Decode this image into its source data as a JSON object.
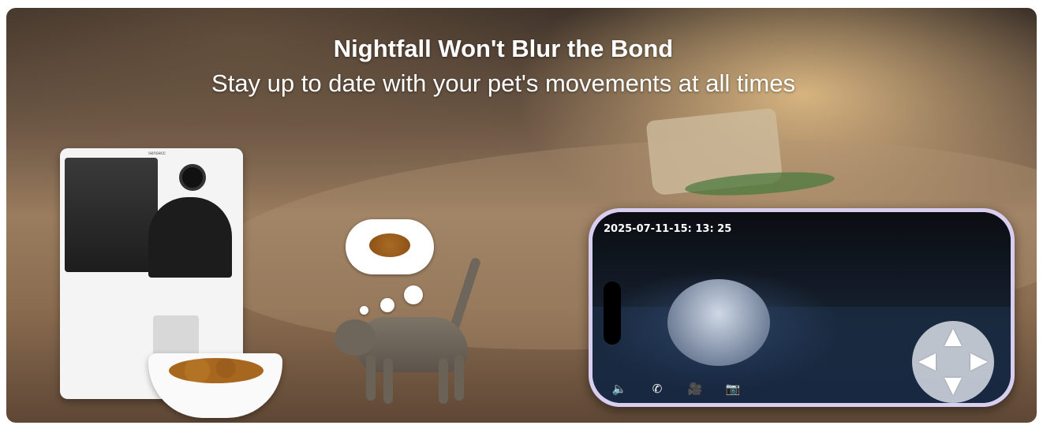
{
  "banner": {
    "headline": "Nightfall Won't Blur the Bond",
    "subline": "Stay up to date with your pet's movements at all times"
  },
  "feeder": {
    "brand": "sensecc"
  },
  "phone": {
    "timestamp": "2025-07-11-15: 13: 25",
    "controls": [
      {
        "name": "speaker-icon",
        "glyph": "🔈"
      },
      {
        "name": "phone-call-icon",
        "glyph": "✆"
      },
      {
        "name": "video-record-icon",
        "glyph": "🎥"
      },
      {
        "name": "camera-snapshot-icon",
        "glyph": "📷"
      }
    ],
    "dpad": {
      "icons": [
        "arrow-up-icon",
        "arrow-down-icon",
        "arrow-left-icon",
        "arrow-right-icon"
      ]
    }
  },
  "colors": {
    "text": "#ffffff",
    "phone_frame": "#d8cff0",
    "dpad_bg": "#ebeef5"
  }
}
